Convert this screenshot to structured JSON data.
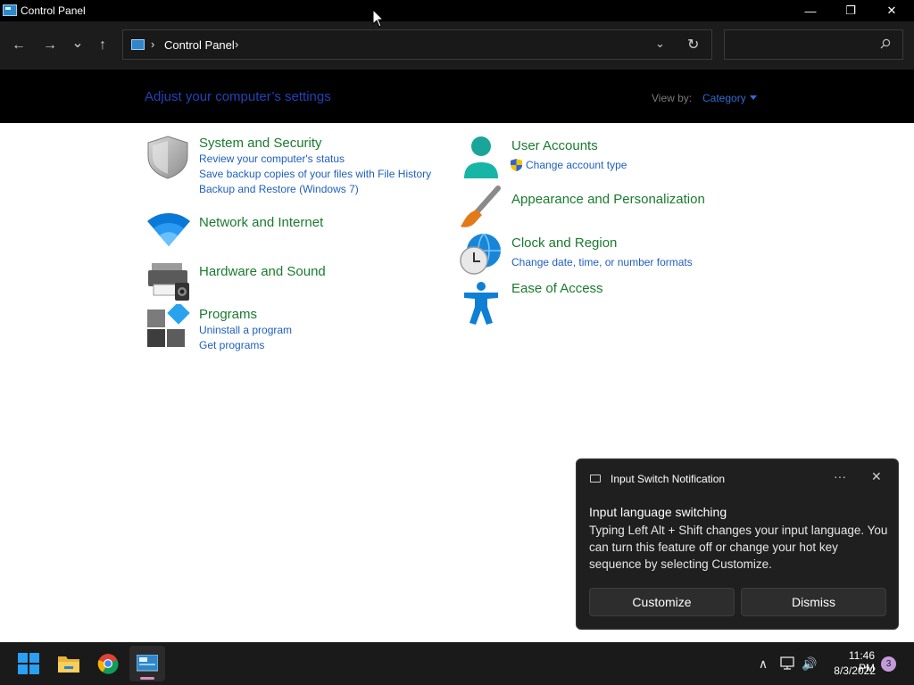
{
  "window": {
    "title": "Control Panel",
    "minimize_glyph": "—",
    "maximize_glyph": "❐",
    "close_glyph": "✕"
  },
  "nav": {
    "back_glyph": "←",
    "forward_glyph": "→",
    "recent_glyph": "⌄",
    "up_glyph": "↑",
    "address": {
      "path": "Control Panel",
      "separator": "›",
      "dropdown_glyph": "⌄",
      "refresh_glyph": "↻"
    },
    "search": {
      "placeholder": "",
      "value": ""
    }
  },
  "header": {
    "heading": "Adjust your computer’s settings",
    "view_by_label": "View by:",
    "view_by_value": "Category"
  },
  "categories_left": [
    {
      "title": "System and Security",
      "icon": "shield-icon",
      "links": [
        "Review your computer's status",
        "Save backup copies of your files with File History",
        "Backup and Restore (Windows 7)"
      ]
    },
    {
      "title": "Network and Internet",
      "icon": "network-icon",
      "links": []
    },
    {
      "title": "Hardware and Sound",
      "icon": "printer-icon",
      "links": []
    },
    {
      "title": "Programs",
      "icon": "programs-icon",
      "links": [
        "Uninstall a program",
        "Get programs"
      ]
    }
  ],
  "categories_right": [
    {
      "title": "User Accounts",
      "icon": "user-icon",
      "links": [
        "Change account type"
      ]
    },
    {
      "title": "Appearance and Personalization",
      "icon": "brush-icon",
      "links": []
    },
    {
      "title": "Clock and Region",
      "icon": "clock-globe-icon",
      "links": [
        "Change date, time, or number formats"
      ]
    },
    {
      "title": "Ease of Access",
      "icon": "accessibility-icon",
      "links": []
    }
  ],
  "notification": {
    "app_name": "Input Switch Notification",
    "more_glyph": "···",
    "close_glyph": "✕",
    "title": "Input language switching",
    "body": "Typing Left Alt + Shift changes your input language. You can turn this feature off or change your hot key sequence by selecting Customize.",
    "customize_label": "Customize",
    "dismiss_label": "Dismiss"
  },
  "taskbar": {
    "apps": [
      "start-icon",
      "file-explorer-icon",
      "chrome-icon",
      "control-panel-icon"
    ],
    "tray": {
      "chevron_glyph": "∧",
      "speaker_glyph": "🔊"
    },
    "time": "11:46 PM",
    "date": "8/3/2022",
    "notification_count": "3"
  },
  "colors": {
    "heading_blue": "#1f43b8",
    "category_green": "#1a7b2e",
    "link_blue": "#1e5fbf",
    "view_by_blue": "#2f6bd3"
  }
}
